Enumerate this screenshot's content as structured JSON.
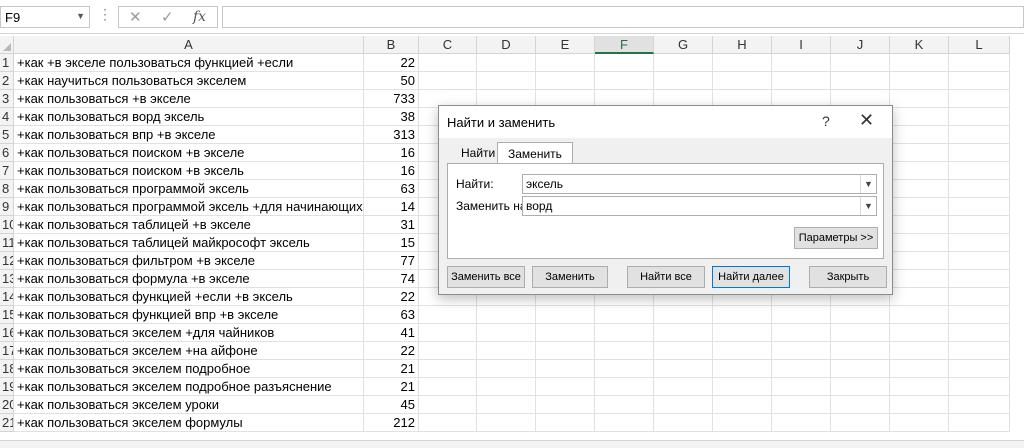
{
  "formula_bar": {
    "namebox": "F9",
    "fx": "fx",
    "cancel_symbol": "✕",
    "enter_symbol": "✓",
    "value": ""
  },
  "columns": [
    "A",
    "B",
    "C",
    "D",
    "E",
    "F",
    "G",
    "H",
    "I",
    "J",
    "K",
    "L"
  ],
  "selected_column": "F",
  "rows": [
    {
      "n": "1",
      "a": "+как +в экселе пользоваться функцией +если",
      "b": "22"
    },
    {
      "n": "2",
      "a": "+как научиться пользоваться экселем",
      "b": "50"
    },
    {
      "n": "3",
      "a": "+как пользоваться +в экселе",
      "b": "733"
    },
    {
      "n": "4",
      "a": "+как пользоваться ворд эксель",
      "b": "38"
    },
    {
      "n": "5",
      "a": "+как пользоваться впр +в экселе",
      "b": "313"
    },
    {
      "n": "6",
      "a": "+как пользоваться поиском +в экселе",
      "b": "16"
    },
    {
      "n": "7",
      "a": "+как пользоваться поиском +в эксель",
      "b": "16"
    },
    {
      "n": "8",
      "a": "+как пользоваться программой эксель",
      "b": "63"
    },
    {
      "n": "9",
      "a": "+как пользоваться программой эксель +для начинающих",
      "b": "14"
    },
    {
      "n": "10",
      "a": "+как пользоваться таблицей +в экселе",
      "b": "31"
    },
    {
      "n": "11",
      "a": "+как пользоваться таблицей майкрософт эксель",
      "b": "15"
    },
    {
      "n": "12",
      "a": "+как пользоваться фильтром +в экселе",
      "b": "77"
    },
    {
      "n": "13",
      "a": "+как пользоваться формула +в экселе",
      "b": "74"
    },
    {
      "n": "14",
      "a": "+как пользоваться функцией +если +в эксель",
      "b": "22"
    },
    {
      "n": "15",
      "a": "+как пользоваться функцией впр +в экселе",
      "b": "63"
    },
    {
      "n": "16",
      "a": "+как пользоваться экселем +для чайников",
      "b": "41"
    },
    {
      "n": "17",
      "a": "+как пользоваться экселем +на айфоне",
      "b": "22"
    },
    {
      "n": "18",
      "a": "+как пользоваться экселем подробное",
      "b": "21"
    },
    {
      "n": "19",
      "a": "+как пользоваться экселем подробное разъяснение",
      "b": "21"
    },
    {
      "n": "20",
      "a": "+как пользоваться экселем уроки",
      "b": "45"
    },
    {
      "n": "21",
      "a": "+как пользоваться экселем формулы",
      "b": "212"
    }
  ],
  "dialog": {
    "title": "Найти и заменить",
    "help": "?",
    "close": "✕",
    "tabs": {
      "find": "Найти",
      "replace": "Заменить"
    },
    "find_label": "Найти:",
    "replace_label": "Заменить на:",
    "find_value": "эксель",
    "replace_value": "ворд",
    "params_button": "Параметры >>",
    "buttons": {
      "replace_all": "Заменить все",
      "replace": "Заменить",
      "find_all": "Найти все",
      "find_next": "Найти далее",
      "close": "Закрыть"
    }
  }
}
